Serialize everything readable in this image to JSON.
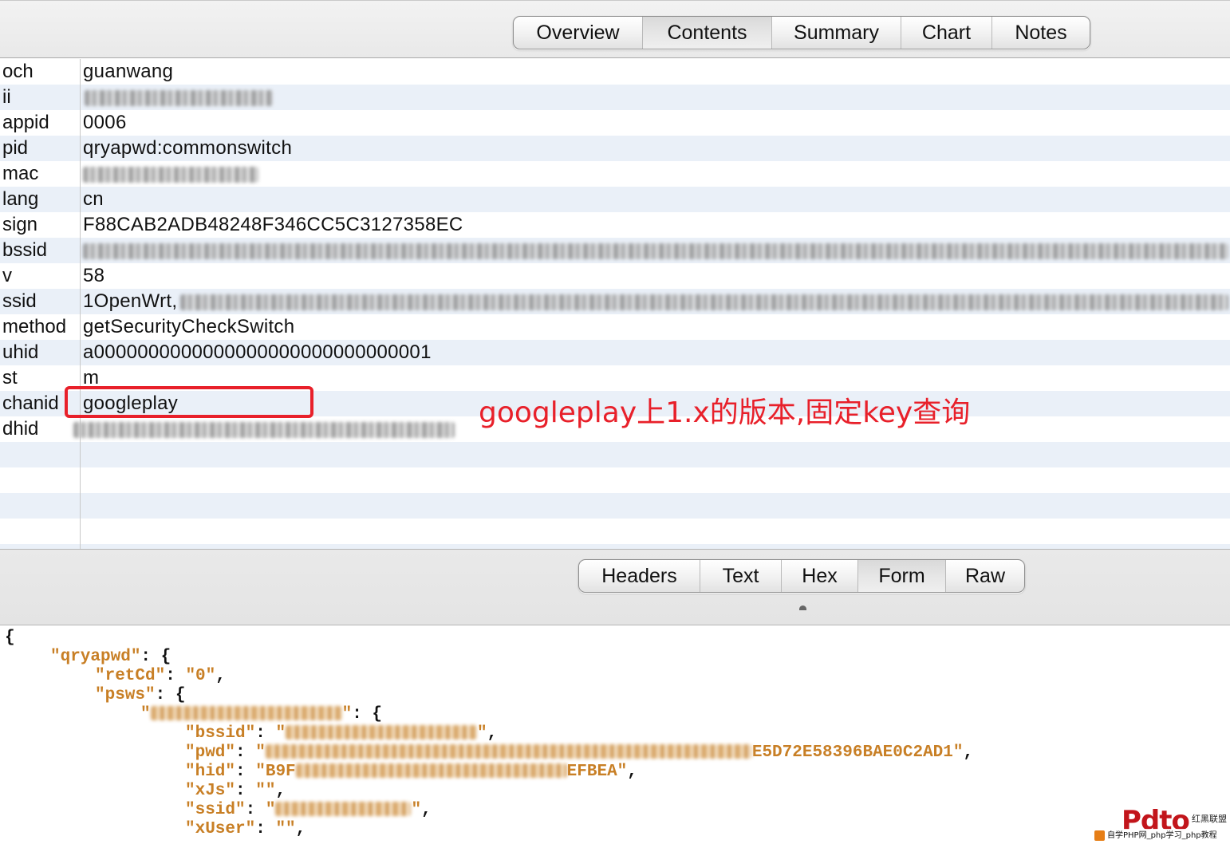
{
  "top_tabs": [
    {
      "label": "Overview",
      "active": false
    },
    {
      "label": "Contents",
      "active": true
    },
    {
      "label": "Summary",
      "active": false
    },
    {
      "label": "Chart",
      "active": false
    },
    {
      "label": "Notes",
      "active": false
    }
  ],
  "form_rows": [
    {
      "key": "och",
      "value": "guanwang"
    },
    {
      "key": "ii",
      "value": ""
    },
    {
      "key": "appid",
      "value": "0006"
    },
    {
      "key": "pid",
      "value": "qryapwd:commonswitch"
    },
    {
      "key": "mac",
      "value": ""
    },
    {
      "key": "lang",
      "value": "cn"
    },
    {
      "key": "sign",
      "value": "F88CAB2ADB48248F346CC5C3127358EC"
    },
    {
      "key": "bssid",
      "value": ""
    },
    {
      "key": "v",
      "value": "58"
    },
    {
      "key": "ssid",
      "value": "1OpenWrt,"
    },
    {
      "key": "method",
      "value": "getSecurityCheckSwitch"
    },
    {
      "key": "uhid",
      "value": "a0000000000000000000000000000001"
    },
    {
      "key": "st",
      "value": "m"
    },
    {
      "key": "chanid",
      "value": "googleplay"
    },
    {
      "key": "dhid",
      "value": ""
    }
  ],
  "annotation": "googleplay上1.x的版本,固定key查询",
  "bottom_tabs": [
    {
      "label": "Headers",
      "active": false
    },
    {
      "label": "Text",
      "active": false
    },
    {
      "label": "Hex",
      "active": false
    },
    {
      "label": "Form",
      "active": true
    },
    {
      "label": "Raw",
      "active": false
    }
  ],
  "json_response": {
    "open_brace": "{",
    "qryapwd_key": "\"qryapwd\"",
    "retCd_key": "\"retCd\"",
    "retCd_value": "\"0\"",
    "psws_key": "\"psws\"",
    "bssid_key": "\"bssid\"",
    "pwd_key": "\"pwd\"",
    "pwd_value_tail": "E5D72E58396BAE0C2AD1\"",
    "hid_key": "\"hid\"",
    "hid_value_head": "\"B9F",
    "hid_value_tail": "EFBEA\"",
    "xJs_key": "\"xJs\"",
    "xJs_value": "\"\"",
    "ssid_key": "\"ssid\"",
    "xUser_key": "\"xUser\"",
    "xUser_value": "\"\""
  },
  "watermark": {
    "logo": "Pdto",
    "tagline": "红黑联盟",
    "site_text": "自学PHP网_php学习_php教程"
  },
  "colors": {
    "annotation_red": "#e8202a",
    "json_string_orange": "#c87f25",
    "row_stripe": "#eaf0f8"
  }
}
